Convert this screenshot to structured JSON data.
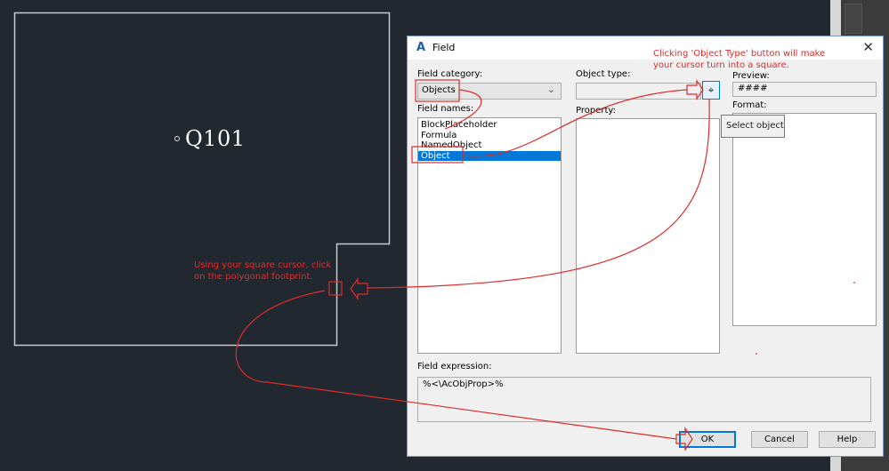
{
  "drawing": {
    "room_label": "Q101",
    "background_color": "#212830",
    "outline_color": "#c8ccd2"
  },
  "annotations": {
    "accent_color": "#e02b2b",
    "object_type_note_line1": "Clicking 'Object Type' button will make",
    "object_type_note_line2": "your cursor turn into a square.",
    "cursor_note_line1": "Using your square cursor, click",
    "cursor_note_line2": "on the polygonal footprint."
  },
  "dialog": {
    "title": "Field",
    "app_icon": "autocad-a-icon",
    "field_category_label": "Field category:",
    "field_category_value": "Objects",
    "field_names_label": "Field names:",
    "field_names": [
      {
        "label": "BlockPlaceholder",
        "selected": false
      },
      {
        "label": "Formula",
        "selected": false
      },
      {
        "label": "NamedObject",
        "selected": false
      },
      {
        "label": "Object",
        "selected": true
      }
    ],
    "object_type_label": "Object type:",
    "object_type_value": "",
    "select_object_tooltip": "Select object",
    "property_label": "Property:",
    "preview_label": "Preview:",
    "preview_value": "####",
    "format_label": "Format:",
    "field_expression_label": "Field expression:",
    "field_expression_value": "%<\\AcObjProp>%",
    "buttons": {
      "ok": "OK",
      "cancel": "Cancel",
      "help": "Help"
    },
    "selection_color": "#0078d7"
  }
}
